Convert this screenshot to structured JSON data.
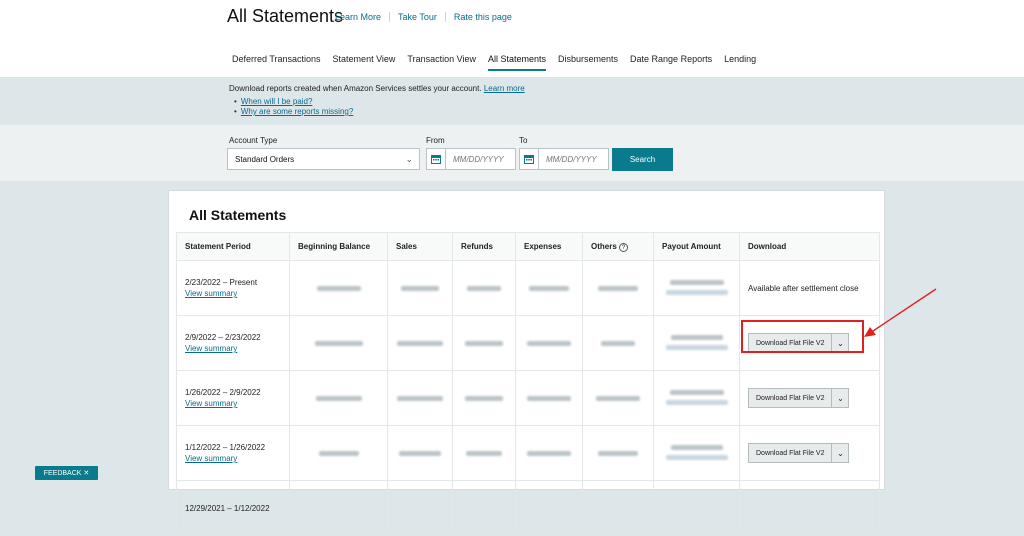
{
  "header": {
    "title": "All Statements",
    "links": [
      "Learn More",
      "Take Tour",
      "Rate this page"
    ]
  },
  "tabs": [
    {
      "label": "Deferred Transactions",
      "active": false
    },
    {
      "label": "Statement View",
      "active": false
    },
    {
      "label": "Transaction View",
      "active": false
    },
    {
      "label": "All Statements",
      "active": true
    },
    {
      "label": "Disbursements",
      "active": false
    },
    {
      "label": "Date Range Reports",
      "active": false
    },
    {
      "label": "Lending",
      "active": false
    }
  ],
  "info": {
    "text": "Download reports created when Amazon Services settles your account.",
    "learn_more": "Learn more",
    "bullets": [
      "When will I be paid?",
      "Why are some reports missing?"
    ]
  },
  "search": {
    "account_type_label": "Account Type",
    "account_type_value": "Standard Orders",
    "from_label": "From",
    "to_label": "To",
    "from_placeholder": "MM/DD/YYYY",
    "to_placeholder": "MM/DD/YYYY",
    "search_button": "Search"
  },
  "card": {
    "title": "All Statements",
    "columns": [
      "Statement Period",
      "Beginning Balance",
      "Sales",
      "Refunds",
      "Expenses",
      "Others",
      "Payout Amount",
      "Download"
    ],
    "view_summary": "View summary",
    "rows": [
      {
        "period": "2/23/2022 – Present",
        "download": "Available after settlement close"
      },
      {
        "period": "2/9/2022 – 2/23/2022",
        "download": "Download Flat File V2"
      },
      {
        "period": "1/26/2022 – 2/9/2022",
        "download": "Download Flat File V2"
      },
      {
        "period": "1/12/2022 – 1/26/2022",
        "download": "Download Flat File V2"
      },
      {
        "period": "12/29/2021 – 1/12/2022",
        "download": ""
      }
    ]
  },
  "feedback": "FEEDBACK ✕",
  "colors": {
    "accent": "#0a7b8d",
    "highlight": "#e21f1f"
  }
}
